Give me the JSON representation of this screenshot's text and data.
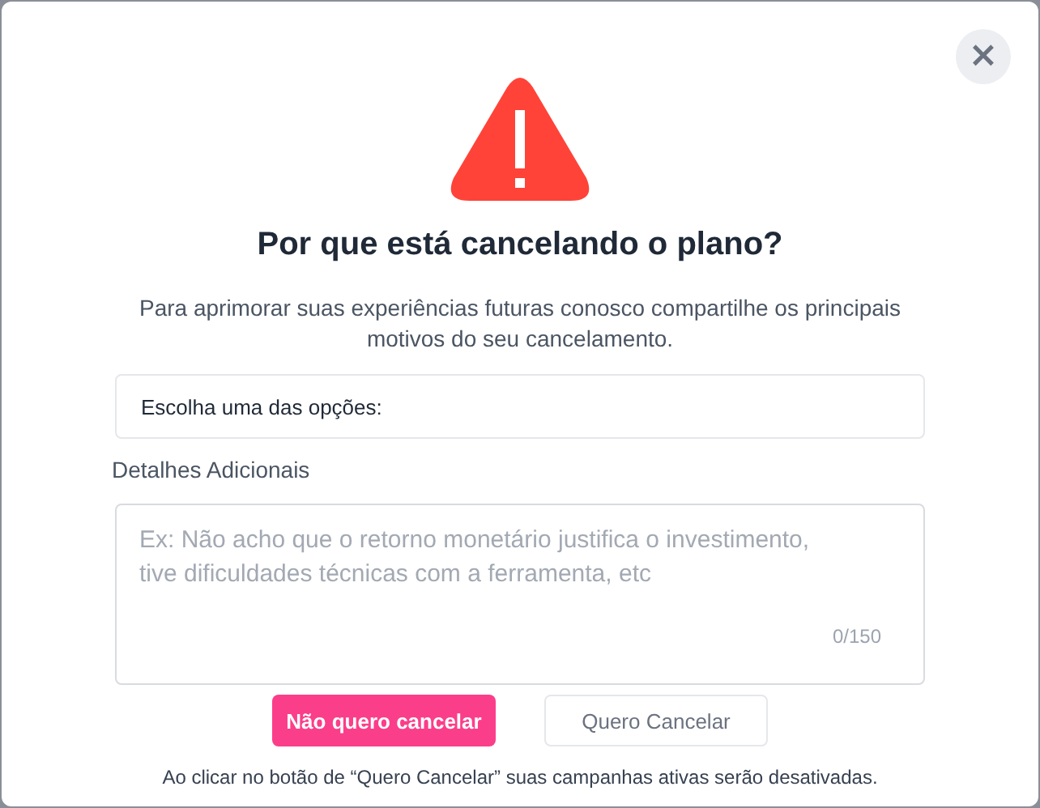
{
  "dialog": {
    "close": "×",
    "title": "Por que está cancelando o plano?",
    "description": "Para aprimorar suas experiências futuras conosco compartilhe os principais motivos do seu cancelamento.",
    "select": {
      "placeholder": "Escolha uma das opções:"
    },
    "details": {
      "label": "Detalhes Adicionais",
      "placeholder": "Ex: Não acho que o retorno monetário justifica o investimento, tive dificuldades técnicas com a ferramenta, etc",
      "counter": "0/150"
    },
    "buttons": [
      {
        "label": "Não quero cancelar",
        "kind": "primary"
      },
      {
        "label": "Quero Cancelar",
        "kind": "secondary"
      }
    ],
    "note": "Ao clicar no botão de “Quero Cancelar” suas campanhas ativas serão desativadas."
  }
}
